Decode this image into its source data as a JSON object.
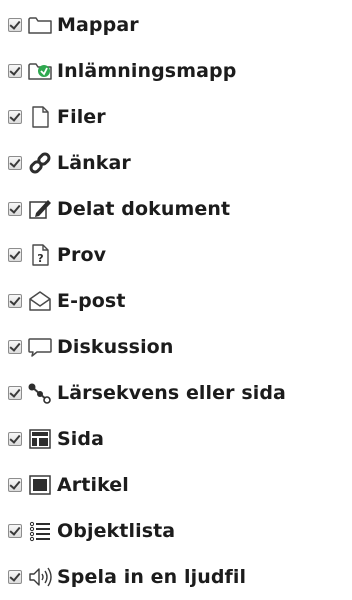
{
  "items": [
    {
      "label": "Mappar",
      "icon": "folder-icon",
      "checked": true
    },
    {
      "label": "Inlämningsmapp",
      "icon": "dropbox-folder-icon",
      "checked": true
    },
    {
      "label": "Filer",
      "icon": "file-icon",
      "checked": true
    },
    {
      "label": "Länkar",
      "icon": "link-icon",
      "checked": true
    },
    {
      "label": "Delat dokument",
      "icon": "edit-document-icon",
      "checked": true
    },
    {
      "label": "Prov",
      "icon": "quiz-icon",
      "checked": true
    },
    {
      "label": "E-post",
      "icon": "envelope-icon",
      "checked": true
    },
    {
      "label": "Diskussion",
      "icon": "speech-bubble-icon",
      "checked": true
    },
    {
      "label": "Lärsekvens eller sida",
      "icon": "learning-path-icon",
      "checked": true
    },
    {
      "label": "Sida",
      "icon": "page-layout-icon",
      "checked": true
    },
    {
      "label": "Artikel",
      "icon": "article-icon",
      "checked": true
    },
    {
      "label": "Objektlista",
      "icon": "list-icon",
      "checked": true
    },
    {
      "label": "Spela in en ljudfil",
      "icon": "speaker-icon",
      "checked": true
    }
  ],
  "colors": {
    "text": "#1c1c1c",
    "icon_accent_green": "#2fa84f",
    "icon_stroke": "#3a3a3a"
  }
}
